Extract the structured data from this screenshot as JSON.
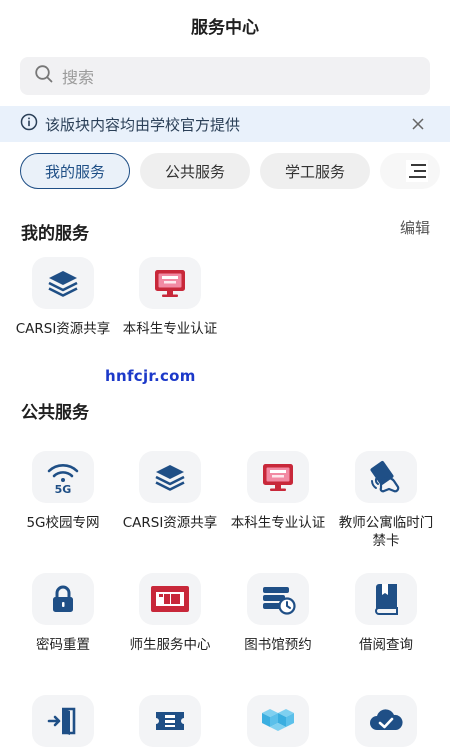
{
  "header": {
    "title": "服务中心"
  },
  "search": {
    "placeholder": "搜索"
  },
  "notice": {
    "text": "该版块内容均由学校官方提供"
  },
  "tabs": [
    {
      "label": "我的服务",
      "active": true
    },
    {
      "label": "公共服务",
      "active": false
    },
    {
      "label": "学工服务",
      "active": false
    },
    {
      "label": "",
      "active": false
    }
  ],
  "my_services": {
    "title": "我的服务",
    "edit_label": "编辑",
    "items": [
      {
        "label": "CARSI资源共享",
        "icon": "layers-icon"
      },
      {
        "label": "本科生专业认证",
        "icon": "monitor-certificate-icon"
      }
    ]
  },
  "watermark": "hnfcjr.com",
  "public_services": {
    "title": "公共服务",
    "items": [
      {
        "label": "5G校园专网",
        "icon": "5g-wifi-icon"
      },
      {
        "label": "CARSI资源共享",
        "icon": "layers-icon"
      },
      {
        "label": "本科生专业认证",
        "icon": "monitor-certificate-icon"
      },
      {
        "label": "教师公寓临时门禁卡",
        "icon": "card-tap-icon"
      },
      {
        "label": "密码重置",
        "icon": "lock-icon"
      },
      {
        "label": "师生服务中心",
        "icon": "service-center-icon"
      },
      {
        "label": "图书馆预约",
        "icon": "library-clock-icon"
      },
      {
        "label": "借阅查询",
        "icon": "book-icon"
      },
      {
        "label": "",
        "icon": "door-exit-icon"
      },
      {
        "label": "",
        "icon": "ticket-icon"
      },
      {
        "label": "",
        "icon": "cubes-icon"
      },
      {
        "label": "",
        "icon": "cloud-check-icon"
      }
    ]
  },
  "colors": {
    "primary": "#1f4f86",
    "icon_bg": "#f3f4f6",
    "notice_bg": "#e9f1fb",
    "pink": "#f28aa3",
    "red": "#c8283a"
  }
}
